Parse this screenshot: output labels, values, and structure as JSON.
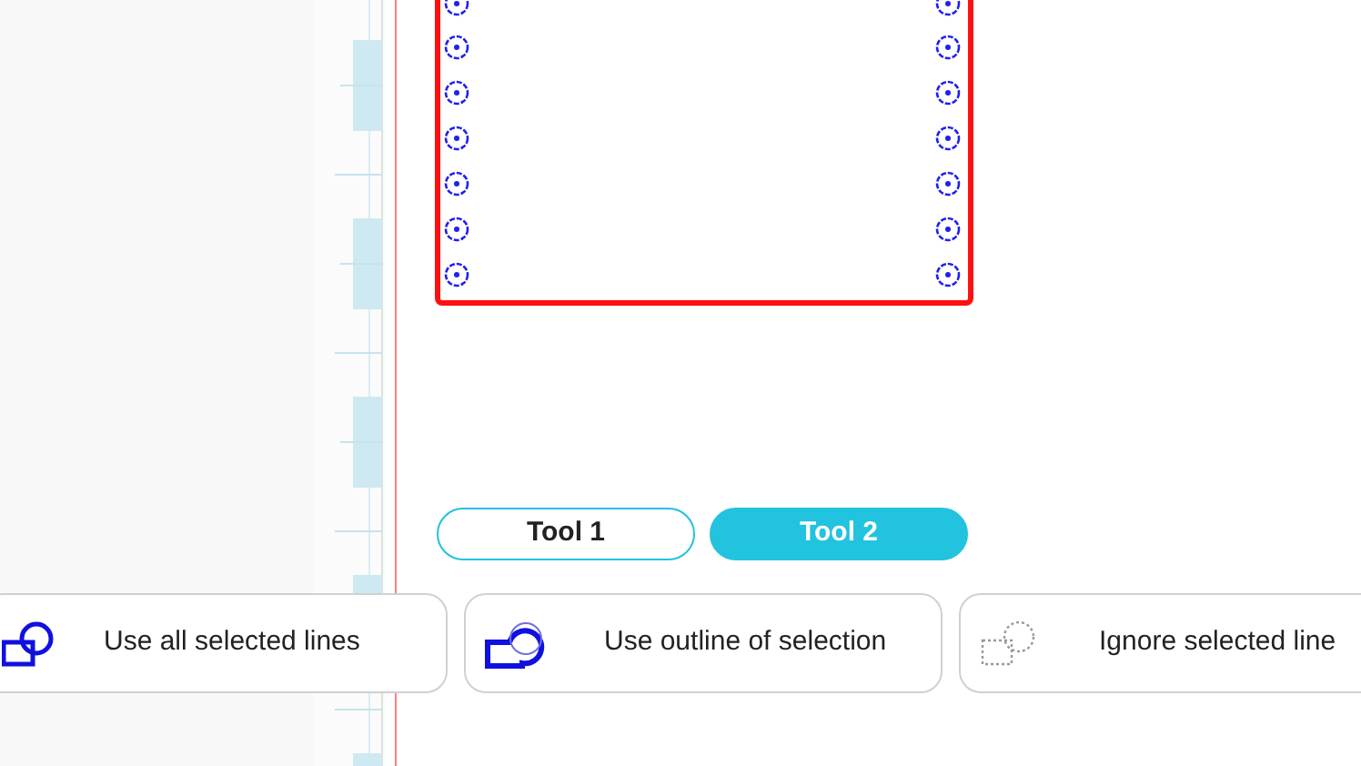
{
  "canvas": {
    "pins": [
      {
        "selected": false
      },
      {
        "selected": false
      }
    ]
  },
  "tools": [
    {
      "label": "Tool 1",
      "selected": false
    },
    {
      "label": "Tool 2",
      "selected": true
    }
  ],
  "options": [
    {
      "kind": "all",
      "label": "Use all selected lines"
    },
    {
      "kind": "outline",
      "label": "Use outline of selection"
    },
    {
      "kind": "ignore",
      "label": "Ignore selected line"
    }
  ]
}
